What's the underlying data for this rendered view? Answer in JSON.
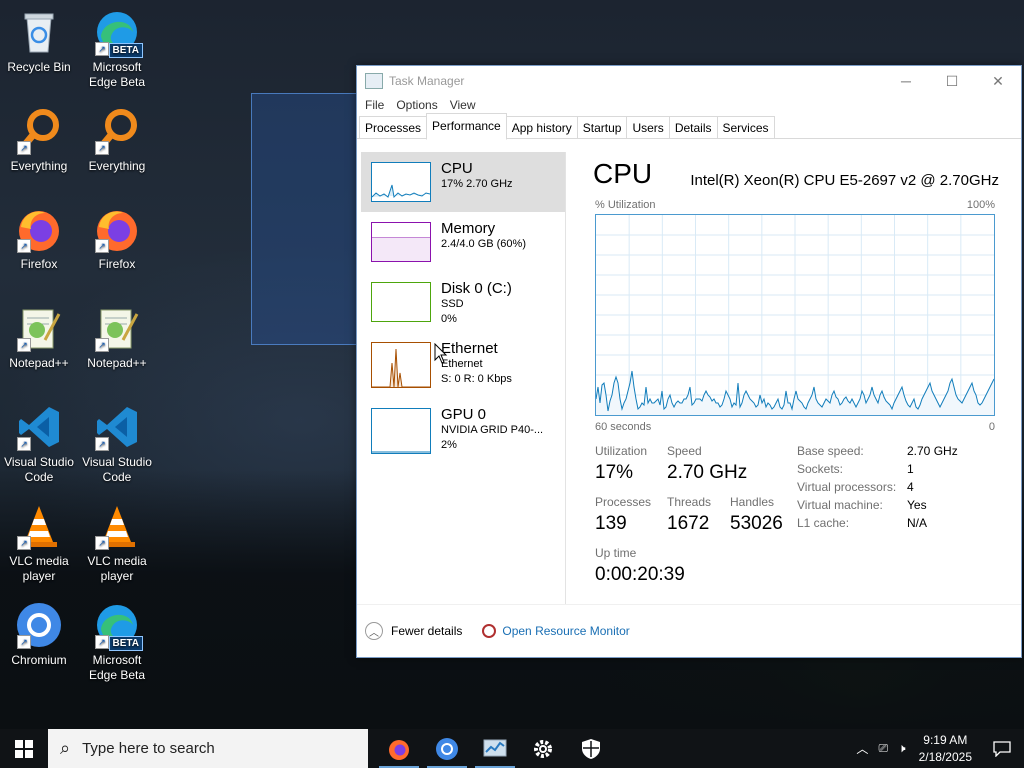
{
  "desktop": {
    "icons": [
      {
        "label": "Recycle Bin"
      },
      {
        "label": "Microsoft Edge Beta",
        "badge": "BETA"
      },
      {
        "label": "Everything"
      },
      {
        "label": "Everything"
      },
      {
        "label": "Firefox"
      },
      {
        "label": "Firefox"
      },
      {
        "label": "Notepad++"
      },
      {
        "label": "Notepad++"
      },
      {
        "label": "Visual Studio Code"
      },
      {
        "label": "Visual Studio Code"
      },
      {
        "label": "VLC media player"
      },
      {
        "label": "VLC media player"
      },
      {
        "label": "Chromium"
      },
      {
        "label": "Microsoft Edge Beta",
        "badge": "BETA"
      }
    ]
  },
  "window": {
    "title": "Task Manager",
    "menu": [
      "File",
      "Options",
      "View"
    ],
    "tabs": [
      "Processes",
      "Performance",
      "App history",
      "Startup",
      "Users",
      "Details",
      "Services"
    ],
    "active_tab": "Performance"
  },
  "sidebar": {
    "items": [
      {
        "name": "CPU",
        "line1": "17%  2.70 GHz",
        "line2": "",
        "line3": "",
        "color": "#117dbb"
      },
      {
        "name": "Memory",
        "line1": "2.4/4.0 GB (60%)",
        "line2": "",
        "line3": "",
        "color": "#8b12ae"
      },
      {
        "name": "Disk 0 (C:)",
        "line1": "SSD",
        "line2": "0%",
        "line3": "",
        "color": "#4da60c"
      },
      {
        "name": "Ethernet",
        "line1": "Ethernet",
        "line2": "S: 0  R: 0 Kbps",
        "line3": "",
        "color": "#a74f01"
      },
      {
        "name": "GPU 0",
        "line1": "NVIDIA GRID P40-...",
        "line2": "2%",
        "line3": "",
        "color": "#117dbb"
      }
    ]
  },
  "main": {
    "title": "CPU",
    "description": "Intel(R) Xeon(R) CPU E5-2697 v2 @ 2.70GHz",
    "graph_label": "% Utilization",
    "graph_max": "100%",
    "graph_time": "60 seconds",
    "graph_zero": "0",
    "graph_color": "#117dbb",
    "utilization_history": [
      8,
      14,
      6,
      15,
      16,
      10,
      2,
      7,
      10,
      16,
      19,
      16,
      8,
      3,
      6,
      8,
      12,
      16,
      22,
      14,
      8,
      3,
      4,
      6,
      5,
      14,
      6,
      8,
      6,
      6,
      7,
      8,
      5,
      12,
      3,
      4,
      8,
      10,
      6,
      4,
      6,
      7,
      6,
      6,
      8,
      8,
      10,
      14,
      5,
      6,
      8,
      8,
      8,
      7,
      10,
      12,
      10,
      9,
      7,
      8,
      6,
      6,
      4,
      5,
      8,
      12,
      10,
      8,
      4,
      6,
      5,
      16,
      4,
      6,
      10,
      12,
      10,
      8,
      7,
      6,
      4,
      5,
      10,
      6,
      8,
      4,
      6,
      5,
      3,
      4,
      6,
      8,
      4,
      3,
      5,
      12,
      6,
      6,
      3,
      8,
      12,
      8,
      7,
      6,
      4,
      3,
      6,
      8,
      10,
      14,
      8,
      6,
      5,
      4,
      6,
      8,
      7,
      6,
      10,
      12,
      9,
      8,
      5,
      6,
      8,
      9,
      7,
      6,
      8,
      6,
      4,
      6,
      8,
      12,
      10,
      6,
      8,
      10,
      14,
      10,
      8,
      6,
      10,
      12,
      9,
      7,
      6,
      5,
      3,
      6,
      8,
      10,
      12,
      14,
      10,
      7,
      5,
      4,
      6,
      8,
      4,
      3,
      5,
      8,
      10,
      12,
      14,
      16,
      12,
      10,
      8,
      6,
      4,
      6,
      8,
      10,
      12,
      16,
      18,
      14,
      10,
      8,
      7,
      6,
      8,
      10,
      12,
      14,
      16,
      12,
      10,
      6,
      5,
      6,
      8,
      10,
      12,
      14,
      16,
      18
    ],
    "stats": {
      "utilization_label": "Utilization",
      "utilization": "17%",
      "speed_label": "Speed",
      "speed": "2.70 GHz",
      "processes_label": "Processes",
      "processes": "139",
      "threads_label": "Threads",
      "threads": "1672",
      "handles_label": "Handles",
      "handles": "53026",
      "uptime_label": "Up time",
      "uptime": "0:00:20:39"
    },
    "details": [
      {
        "k": "Base speed:",
        "v": "2.70 GHz"
      },
      {
        "k": "Sockets:",
        "v": "1"
      },
      {
        "k": "Virtual processors:",
        "v": "4"
      },
      {
        "k": "Virtual machine:",
        "v": "Yes"
      },
      {
        "k": "L1 cache:",
        "v": "N/A"
      }
    ]
  },
  "footer": {
    "fewer_details": "Fewer details",
    "resource_monitor": "Open Resource Monitor"
  },
  "taskbar": {
    "search_placeholder": "Type here to search",
    "time": "9:19 AM",
    "date": "2/18/2025"
  }
}
